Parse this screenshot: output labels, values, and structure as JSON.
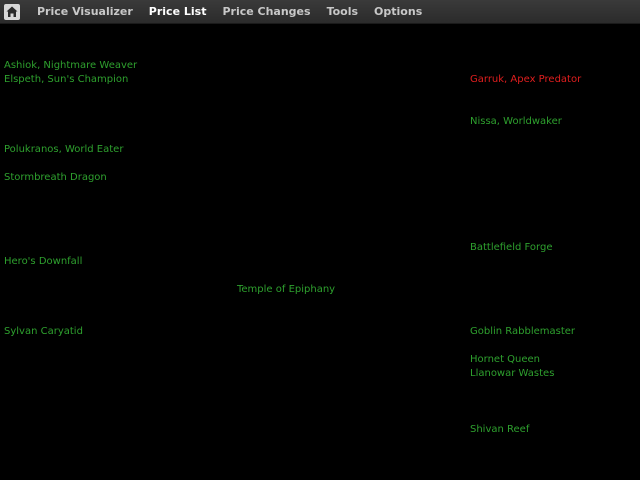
{
  "menu": {
    "home_icon": "home-icon",
    "items": [
      {
        "label": "Price Visualizer"
      },
      {
        "label": "Price List"
      },
      {
        "label": "Price Changes"
      },
      {
        "label": "Tools"
      },
      {
        "label": "Options"
      }
    ],
    "active_item": "Price List"
  },
  "colors": {
    "background": "#000000",
    "menubar": "#2e2e2e",
    "card_default": "#2ea02e",
    "card_highlight": "#e01e1e"
  },
  "cards": [
    {
      "name": "Ashiok, Nightmare Weaver"
    },
    {
      "name": "Elspeth, Sun's Champion"
    },
    {
      "name": "Garruk, Apex Predator",
      "highlight": true
    },
    {
      "name": "Nissa, Worldwaker"
    },
    {
      "name": "Polukranos, World Eater"
    },
    {
      "name": "Stormbreath Dragon"
    },
    {
      "name": "Battlefield Forge"
    },
    {
      "name": "Hero's Downfall"
    },
    {
      "name": "Temple of Epiphany"
    },
    {
      "name": "Sylvan Caryatid"
    },
    {
      "name": "Goblin Rabblemaster"
    },
    {
      "name": "Hornet Queen"
    },
    {
      "name": "Llanowar Wastes"
    },
    {
      "name": "Shivan Reef"
    }
  ]
}
